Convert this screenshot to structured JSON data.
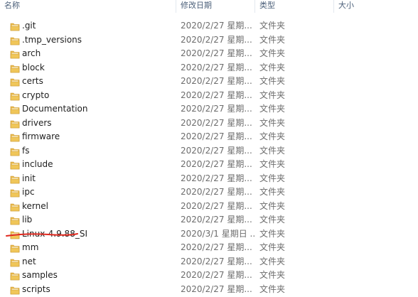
{
  "columns": {
    "name": "名称",
    "date": "修改日期",
    "type": "类型",
    "size": "大小"
  },
  "colors": {
    "header_text": "#4c607a",
    "folder": "#e8b84a",
    "strike": "#e0291f",
    "meta_text": "#6d6d6d"
  },
  "rows": [
    {
      "name": ".git",
      "date": "2020/2/27 星期...",
      "type": "文件夹"
    },
    {
      "name": ".tmp_versions",
      "date": "2020/2/27 星期...",
      "type": "文件夹"
    },
    {
      "name": "arch",
      "date": "2020/2/27 星期...",
      "type": "文件夹"
    },
    {
      "name": "block",
      "date": "2020/2/27 星期...",
      "type": "文件夹"
    },
    {
      "name": "certs",
      "date": "2020/2/27 星期...",
      "type": "文件夹"
    },
    {
      "name": "crypto",
      "date": "2020/2/27 星期...",
      "type": "文件夹"
    },
    {
      "name": "Documentation",
      "date": "2020/2/27 星期...",
      "type": "文件夹"
    },
    {
      "name": "drivers",
      "date": "2020/2/27 星期...",
      "type": "文件夹"
    },
    {
      "name": "firmware",
      "date": "2020/2/27 星期...",
      "type": "文件夹"
    },
    {
      "name": "fs",
      "date": "2020/2/27 星期...",
      "type": "文件夹"
    },
    {
      "name": "include",
      "date": "2020/2/27 星期...",
      "type": "文件夹"
    },
    {
      "name": "init",
      "date": "2020/2/27 星期...",
      "type": "文件夹"
    },
    {
      "name": "ipc",
      "date": "2020/2/27 星期...",
      "type": "文件夹"
    },
    {
      "name": "kernel",
      "date": "2020/2/27 星期...",
      "type": "文件夹"
    },
    {
      "name": "lib",
      "date": "2020/2/27 星期...",
      "type": "文件夹"
    },
    {
      "name": "Linux-4.9.88_SI",
      "date": "2020/3/1 星期日 ...",
      "type": "文件夹"
    },
    {
      "name": "mm",
      "date": "2020/2/27 星期...",
      "type": "文件夹"
    },
    {
      "name": "net",
      "date": "2020/2/27 星期...",
      "type": "文件夹"
    },
    {
      "name": "samples",
      "date": "2020/2/27 星期...",
      "type": "文件夹"
    },
    {
      "name": "scripts",
      "date": "2020/2/27 星期...",
      "type": "文件夹"
    }
  ]
}
